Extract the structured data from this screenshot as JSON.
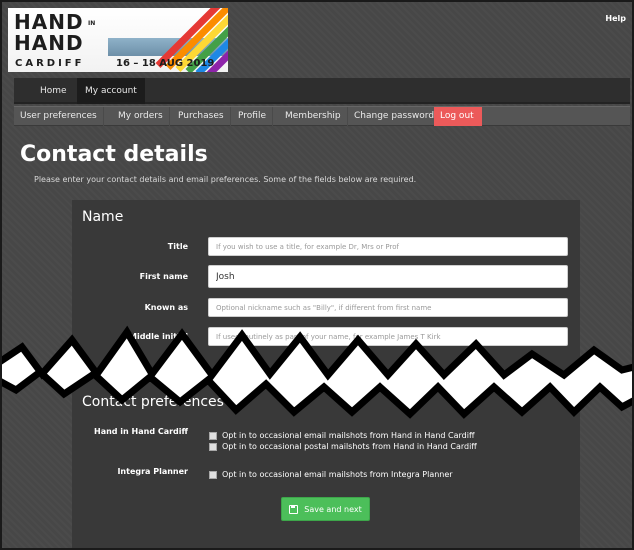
{
  "header": {
    "logo": {
      "line1": "HAND",
      "in": "IN",
      "line2": "HAND",
      "city": "CARDIFF",
      "dates": "16 – 18 AUG 2019"
    },
    "help_label": "Help"
  },
  "main_nav": [
    {
      "label": "Home",
      "active": false
    },
    {
      "label": "My account",
      "active": true
    }
  ],
  "account_nav": [
    {
      "label": "User preferences"
    },
    {
      "label": "My orders"
    },
    {
      "label": "Purchases"
    },
    {
      "label": "Profile"
    },
    {
      "label": "Membership"
    },
    {
      "label": "Change password"
    },
    {
      "label": "Log out"
    }
  ],
  "page": {
    "title": "Contact details",
    "intro": "Please enter your contact details and email preferences. Some of the fields below are required."
  },
  "name_section": {
    "title": "Name",
    "fields": {
      "title": {
        "label": "Title",
        "value": "",
        "placeholder": "If you wish to use a title, for example Dr, Mrs or Prof"
      },
      "first_name": {
        "label": "First name",
        "value": "Josh",
        "placeholder": ""
      },
      "known_as": {
        "label": "Known as",
        "value": "",
        "placeholder": "Optional nickname such as \"Billy\", if different from first name"
      },
      "middle_initial": {
        "label": "Middle initial",
        "value": "",
        "placeholder": "If used routinely as part of your name, for example James T Kirk"
      }
    }
  },
  "contact_preferences": {
    "title": "Contact preferences",
    "groups": [
      {
        "label": "Hand in Hand Cardiff",
        "options": [
          {
            "label": "Opt in to occasional email mailshots from Hand in Hand Cardiff",
            "checked": false
          },
          {
            "label": "Opt in to occasional postal mailshots from Hand in Hand Cardiff",
            "checked": false
          }
        ]
      },
      {
        "label": "Integra Planner",
        "options": [
          {
            "label": "Opt in to occasional email mailshots from Integra Planner",
            "checked": false
          }
        ]
      }
    ]
  },
  "actions": {
    "save_label": "Save and next"
  },
  "colors": {
    "logout": "#ec5a5a",
    "save": "#4cbf5a",
    "background": "#474747",
    "panel": "#393939"
  }
}
